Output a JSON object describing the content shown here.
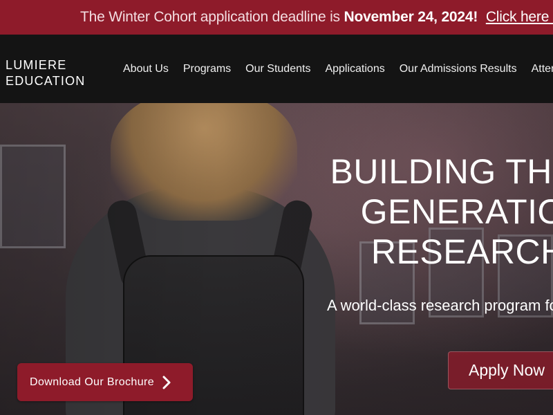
{
  "banner": {
    "prefix": "The Winter Cohort application deadline is",
    "deadline": "November 24, 2024!",
    "link": "Click here to apply"
  },
  "logo": {
    "line1": "LUMIERE",
    "line2": "EDUCATION"
  },
  "nav": {
    "items": [
      {
        "label": "About Us"
      },
      {
        "label": "Programs"
      },
      {
        "label": "Our Students"
      },
      {
        "label": "Applications"
      },
      {
        "label": "Our Admissions Results"
      },
      {
        "label": "Attend"
      }
    ]
  },
  "hero": {
    "headline_lines": [
      "BUILDING THE NEXT",
      "GENERATION OF",
      "RESEARCHERS"
    ],
    "subline": "A world-class research program for high school students",
    "apply_label": "Apply Now",
    "brochure_label": "Download Our Brochure",
    "brochure_icon": "chevron-right-icon",
    "hero_image": "student-with-backpack-photo"
  },
  "colors": {
    "brand": "#8e1b2a",
    "nav_bg": "#141414"
  }
}
